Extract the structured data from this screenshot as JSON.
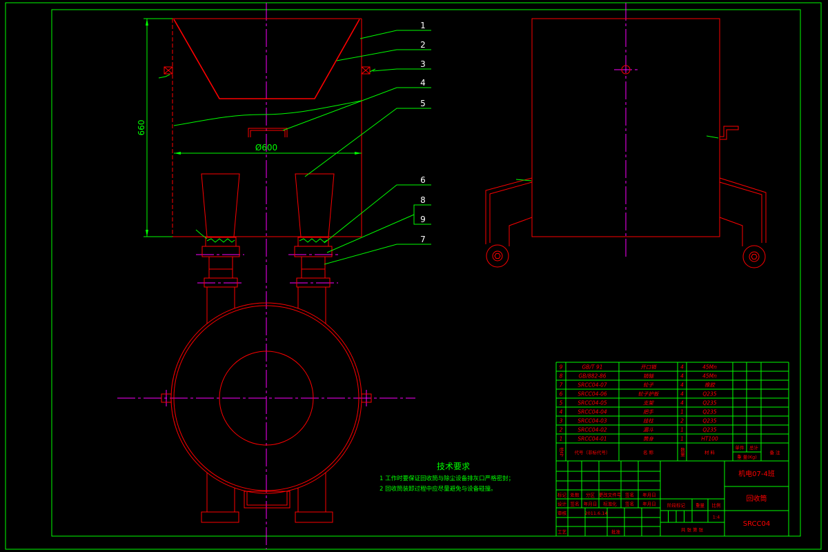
{
  "colors": {
    "background": "#000000",
    "frame": "#00ff00",
    "outline": "#ff0000",
    "centerline": "#ff00ff",
    "dimension": "#00ff00",
    "callout_text": "#ffffff",
    "table_text": "#ff0000"
  },
  "drawing": {
    "dimension_height": "660",
    "dimension_diameter": "Ø600",
    "callouts": [
      "1",
      "2",
      "3",
      "4",
      "5",
      "6",
      "8",
      "9",
      "7"
    ]
  },
  "technical_requirements": {
    "title": "技术要求",
    "items": [
      "1 工作时要保证回收筒与除尘设备排灰口严格密封；",
      "2 回收筒装卸过程中应尽量避免与设备碰撞。"
    ]
  },
  "parts_list": {
    "header": {
      "index": "序号",
      "code": "代号（非标代号）",
      "name": "名  称",
      "quantity": "数量",
      "material": "材  料",
      "unit_weight": "单件",
      "total_weight": "总计",
      "weight": "重 量(Kg)",
      "remarks": "备 注"
    },
    "rows": [
      {
        "index": "9",
        "code": "GB/T 91",
        "name": "开口销",
        "quantity": "4",
        "material": "45Mn"
      },
      {
        "index": "8",
        "code": "GB/882-86",
        "name": "销轴",
        "quantity": "4",
        "material": "45Mn"
      },
      {
        "index": "7",
        "code": "SRCC04-07",
        "name": "轮子",
        "quantity": "4",
        "material": "橡胶"
      },
      {
        "index": "6",
        "code": "SRCC04-06",
        "name": "轮子护板",
        "quantity": "4",
        "material": "Q235"
      },
      {
        "index": "5",
        "code": "SRCC04-05",
        "name": "支架",
        "quantity": "4",
        "material": "Q235"
      },
      {
        "index": "4",
        "code": "SRCC04-04",
        "name": "把手",
        "quantity": "1",
        "material": "Q235"
      },
      {
        "index": "3",
        "code": "SRCC04-03",
        "name": "挂柱",
        "quantity": "2",
        "material": "Q235"
      },
      {
        "index": "2",
        "code": "SRCC04-02",
        "name": "漏斗",
        "quantity": "1",
        "material": "Q235"
      },
      {
        "index": "1",
        "code": "SRCC04-01",
        "name": "筒身",
        "quantity": "1",
        "material": "HT100"
      }
    ]
  },
  "title_block": {
    "class_name": "机电07-4班",
    "drawing_name": "回收筒",
    "drawing_number": "SRCC04",
    "revision_row": [
      "标记",
      "处数",
      "分区",
      "更改文件号",
      "签名",
      "年月日"
    ],
    "design_row": [
      "设计",
      "签名",
      "年月日",
      "标准化",
      "签名",
      "年月日"
    ],
    "review_label": "审核",
    "date": "2011.6.14",
    "process_label": "工艺",
    "approve_label": "批准",
    "stage_mark": "阶段标记",
    "weight": "重量",
    "scale_label": "比例",
    "scale": "1:4",
    "sheets": "共 张 第 张"
  }
}
